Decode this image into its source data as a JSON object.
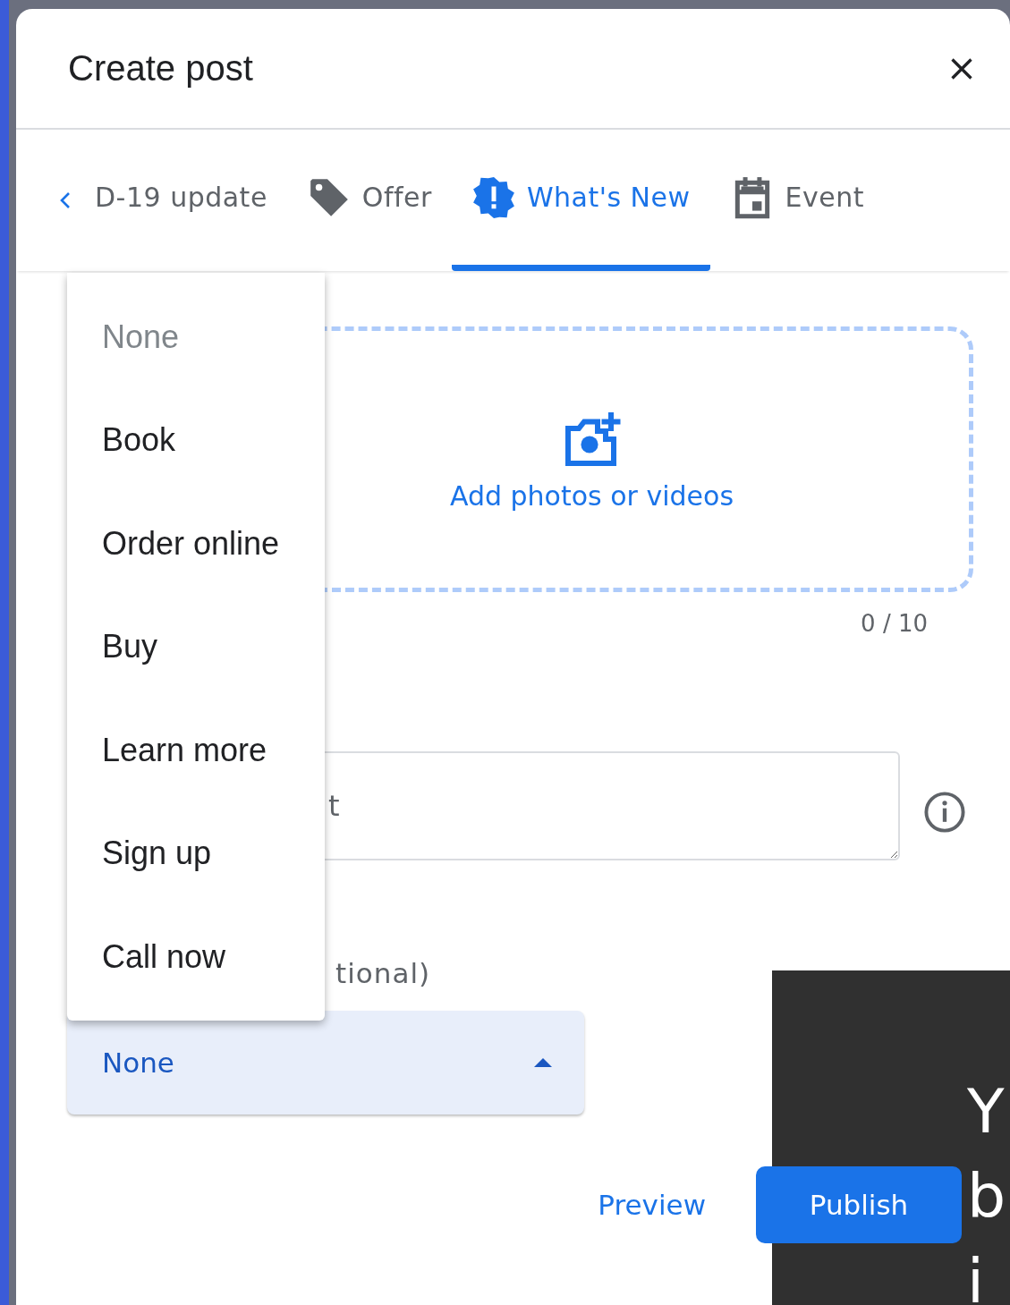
{
  "dialog": {
    "title": "Create post"
  },
  "tabs": [
    {
      "label": "D-19 update",
      "selected": false
    },
    {
      "label": "Offer",
      "selected": false
    },
    {
      "label": "What's New",
      "selected": true
    },
    {
      "label": "Event",
      "selected": false
    }
  ],
  "media": {
    "label": "Add photos or videos",
    "counter": "0 / 10"
  },
  "description": {
    "placeholder": "t"
  },
  "button_field": {
    "label": "tional)",
    "value": "None",
    "expanded": true
  },
  "menu": [
    {
      "label": "None",
      "disabled": true
    },
    {
      "label": "Book",
      "disabled": false
    },
    {
      "label": "Order online",
      "disabled": false
    },
    {
      "label": "Buy",
      "disabled": false
    },
    {
      "label": "Learn more",
      "disabled": false
    },
    {
      "label": "Sign up",
      "disabled": false
    },
    {
      "label": "Call now",
      "disabled": false
    }
  ],
  "actions": [
    {
      "label": "Preview",
      "kind": "text"
    },
    {
      "label": "Publish",
      "kind": "filled"
    }
  ],
  "tooltip": {
    "lines": [
      "Y",
      "b",
      "i"
    ]
  }
}
